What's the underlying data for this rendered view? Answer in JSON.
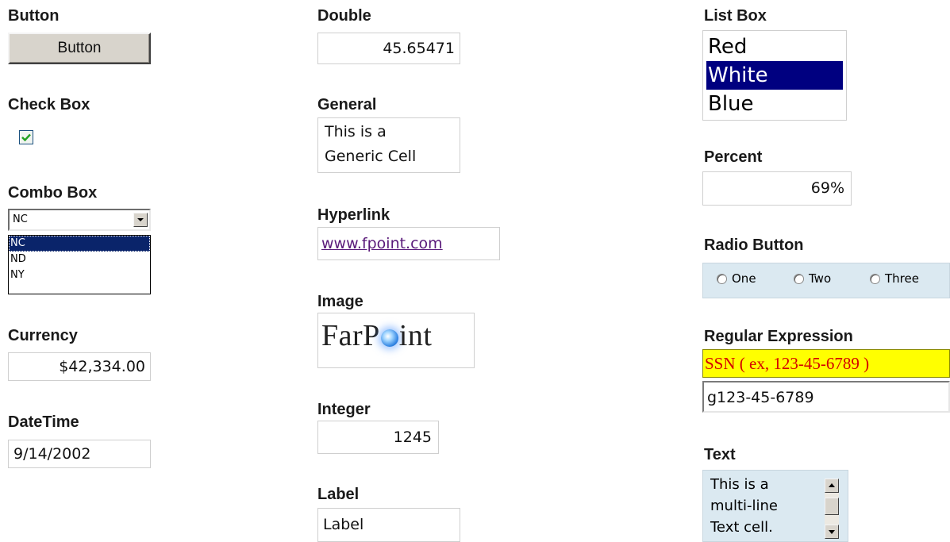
{
  "labels": {
    "button": "Button",
    "checkbox": "Check Box",
    "combobox": "Combo Box",
    "currency": "Currency",
    "datetime": "DateTime",
    "double": "Double",
    "general": "General",
    "hyperlink": "Hyperlink",
    "image": "Image",
    "integer": "Integer",
    "label": "Label",
    "listbox": "List Box",
    "percent": "Percent",
    "radio": "Radio Button",
    "regex": "Regular Expression",
    "text": "Text"
  },
  "button": {
    "text": "Button"
  },
  "checkbox": {
    "checked": true
  },
  "combobox": {
    "value": "NC",
    "options": [
      "NC",
      "ND",
      "NY"
    ],
    "selected_index": 0
  },
  "currency": {
    "value": "$42,334.00"
  },
  "datetime": {
    "value": "9/14/2002"
  },
  "double": {
    "value": "45.65471"
  },
  "general": {
    "line1": "This is a",
    "line2": "Generic Cell"
  },
  "hyperlink": {
    "text": "www.fpoint.com"
  },
  "image": {
    "text_pre": "FarP",
    "text_post": "int"
  },
  "integer": {
    "value": "1245"
  },
  "label_cell": {
    "value": "Label"
  },
  "listbox": {
    "items": [
      "Red",
      "White",
      "Blue"
    ],
    "selected_index": 1
  },
  "percent": {
    "value": "69%"
  },
  "radio": {
    "options": [
      "One",
      "Two",
      "Three"
    ]
  },
  "regex": {
    "hint": "SSN ( ex, 123-45-6789 )",
    "value": "g123-45-6789"
  },
  "text_cell": {
    "lines": [
      "This is a",
      "multi-line",
      "Text cell."
    ]
  },
  "colors": {
    "selection": "#000080",
    "panel": "#dbe9f1",
    "regex_bg": "#ffff00",
    "regex_text": "#d40000",
    "link": "#5a1a7a"
  }
}
